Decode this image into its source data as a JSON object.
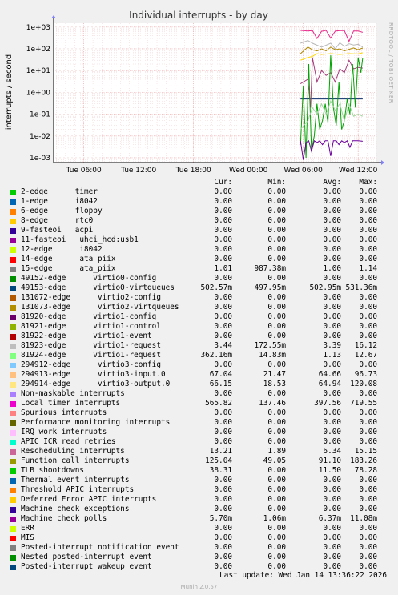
{
  "chart_data": {
    "type": "line",
    "title": "Individual interrupts - by day",
    "ylabel": "interrupts / second",
    "yscale": "log",
    "ylim": [
      0.0006,
      1500
    ],
    "y_ticks": [
      "1e+03",
      "1e+02",
      "1e+01",
      "1e+00",
      "1e-01",
      "1e-02",
      "1e-03"
    ],
    "x_ticks": [
      "Tue 06:00",
      "Tue 12:00",
      "Tue 18:00",
      "Wed 00:00",
      "Wed 06:00",
      "Wed 12:00"
    ],
    "x_range_hours": [
      -33.3,
      2.0
    ],
    "grid": true,
    "watermark": "RRDTOOL / TOBI OETIKER",
    "series": [
      {
        "name": "Local timer interrupts",
        "color": "#e7298a",
        "points": [
          [
            -6.3,
            700
          ],
          [
            -5.5,
            660
          ],
          [
            -5.0,
            690
          ],
          [
            -4.5,
            300
          ],
          [
            -4.0,
            640
          ],
          [
            -3.5,
            700
          ],
          [
            -3.0,
            310
          ],
          [
            -2.5,
            650
          ],
          [
            -2.0,
            680
          ],
          [
            -1.5,
            680
          ],
          [
            -1.0,
            220
          ],
          [
            -0.5,
            660
          ],
          [
            0,
            660
          ],
          [
            0.5,
            570
          ]
        ]
      },
      {
        "name": "virtio1-request",
        "color": "#b7b7b7",
        "points": [
          [
            -6.3,
            180
          ],
          [
            -5.5,
            240
          ],
          [
            -5.0,
            180
          ],
          [
            -4.0,
            120
          ],
          [
            -3.0,
            180
          ],
          [
            -2.5,
            100
          ],
          [
            -2.0,
            190
          ],
          [
            -1.5,
            130
          ],
          [
            -1.0,
            170
          ],
          [
            -0.5,
            150
          ],
          [
            0,
            160
          ],
          [
            0.5,
            120
          ]
        ]
      },
      {
        "name": "Function call interrupts",
        "color": "#af8800",
        "points": [
          [
            -6.3,
            60
          ],
          [
            -5.5,
            120
          ],
          [
            -5.0,
            90
          ],
          [
            -4.5,
            80
          ],
          [
            -4.0,
            100
          ],
          [
            -3.5,
            80
          ],
          [
            -3.0,
            120
          ],
          [
            -2.5,
            90
          ],
          [
            -2.0,
            100
          ],
          [
            -1.5,
            80
          ],
          [
            -1.0,
            95
          ],
          [
            -0.5,
            110
          ],
          [
            0,
            90
          ],
          [
            0.5,
            110
          ]
        ]
      },
      {
        "name": "virtio3-output.0",
        "color": "#ffd700",
        "points": [
          [
            -6.3,
            30
          ],
          [
            -5.5,
            40
          ],
          [
            -5.0,
            45
          ],
          [
            -4.5,
            60
          ],
          [
            -4.0,
            55
          ],
          [
            -3.0,
            60
          ],
          [
            -2.0,
            55
          ],
          [
            -1.0,
            60
          ],
          [
            0,
            58
          ],
          [
            0.5,
            66
          ]
        ]
      },
      {
        "name": "virtio0-virtqueues",
        "color": "#0a2c6a",
        "points": [
          [
            -6.3,
            0.5
          ],
          [
            -5.0,
            0.5
          ],
          [
            -4.0,
            0.5
          ],
          [
            -3.0,
            0.5
          ],
          [
            -2.0,
            0.5
          ],
          [
            -1.0,
            0.5
          ],
          [
            0,
            0.5
          ],
          [
            0.5,
            0.5
          ]
        ]
      },
      {
        "name": "Rescheduling interrupts",
        "color": "#a43e7d",
        "points": [
          [
            -6.3,
            2.5
          ],
          [
            -5.5,
            4
          ],
          [
            -5.2,
            0.2
          ],
          [
            -5.0,
            40
          ],
          [
            -4.5,
            3
          ],
          [
            -4.0,
            10
          ],
          [
            -3.5,
            6
          ],
          [
            -3.0,
            8
          ],
          [
            -2.5,
            3
          ],
          [
            -2.0,
            12
          ],
          [
            -1.5,
            8
          ],
          [
            -1.0,
            30
          ],
          [
            -0.5,
            12
          ],
          [
            0,
            14
          ],
          [
            0.5,
            13
          ]
        ]
      },
      {
        "name": "TLB shootdowns",
        "color": "#00a400",
        "points": [
          [
            -6.3,
            0.004
          ],
          [
            -6.0,
            2
          ],
          [
            -5.7,
            0.001
          ],
          [
            -5.4,
            20
          ],
          [
            -5.1,
            0.002
          ],
          [
            -4.8,
            0.01
          ],
          [
            -4.5,
            0.3
          ],
          [
            -4.2,
            0.02
          ],
          [
            -3.9,
            0.05
          ],
          [
            -3.6,
            0.3
          ],
          [
            -3.3,
            0.04
          ],
          [
            -3.0,
            50
          ],
          [
            -2.7,
            0.2
          ],
          [
            -2.4,
            0.03
          ],
          [
            -2.1,
            3
          ],
          [
            -1.8,
            0.02
          ],
          [
            -1.5,
            0.05
          ],
          [
            -1.2,
            0.5
          ],
          [
            -0.9,
            0.1
          ],
          [
            -0.6,
            20
          ],
          [
            -0.3,
            0.2
          ],
          [
            0,
            40
          ],
          [
            0.3,
            8
          ],
          [
            0.5,
            38
          ]
        ]
      },
      {
        "name": "virtio1-request (avg)",
        "color": "#9fd79f",
        "points": [
          [
            -6.3,
            0.02
          ],
          [
            -5.5,
            0.05
          ],
          [
            -5.0,
            0.2
          ],
          [
            -4.5,
            0.1
          ],
          [
            -4.0,
            0.3
          ],
          [
            -3.5,
            0.1
          ],
          [
            -3.0,
            0.4
          ],
          [
            -2.5,
            0.15
          ],
          [
            -2.0,
            0.3
          ],
          [
            -1.5,
            0.05
          ],
          [
            -1.0,
            0.3
          ],
          [
            -0.5,
            0.08
          ],
          [
            0,
            0.1
          ],
          [
            0.5,
            0.08
          ]
        ]
      },
      {
        "name": "Machine check polls",
        "color": "#6b009b",
        "points": [
          [
            -6.3,
            0.006
          ],
          [
            -6.0,
            0.0008
          ],
          [
            -5.7,
            0.005
          ],
          [
            -5.4,
            0.006
          ],
          [
            -5.1,
            0.002
          ],
          [
            -4.8,
            0.006
          ],
          [
            -4.5,
            0.005
          ],
          [
            -4.2,
            0.006
          ],
          [
            -3.9,
            0.004
          ],
          [
            -3.6,
            0.006
          ],
          [
            -3.3,
            0.006
          ],
          [
            -3.0,
            0.0012
          ],
          [
            -2.7,
            0.006
          ],
          [
            -2.4,
            0.006
          ],
          [
            -2.1,
            0.004
          ],
          [
            -1.8,
            0.006
          ],
          [
            -1.5,
            0.005
          ],
          [
            -1.2,
            0.006
          ],
          [
            -0.9,
            0.003
          ],
          [
            -0.6,
            0.006
          ],
          [
            -0.3,
            0.006
          ],
          [
            0,
            0.006
          ],
          [
            0.5,
            0.0057
          ]
        ]
      }
    ]
  },
  "legend": {
    "headers": {
      "cur": "Cur:",
      "min": "Min:",
      "avg": "Avg:",
      "max": "Max:"
    },
    "rows": [
      {
        "label": "2-edge      timer",
        "color": "#00cc00",
        "cur": "0.00",
        "min": "0.00",
        "avg": "0.00",
        "max": "0.00"
      },
      {
        "label": "1-edge      i8042",
        "color": "#0066b3",
        "cur": "0.00",
        "min": "0.00",
        "avg": "0.00",
        "max": "0.00"
      },
      {
        "label": "6-edge      floppy",
        "color": "#ff8000",
        "cur": "0.00",
        "min": "0.00",
        "avg": "0.00",
        "max": "0.00"
      },
      {
        "label": "8-edge      rtc0",
        "color": "#ffcc00",
        "cur": "0.00",
        "min": "0.00",
        "avg": "0.00",
        "max": "0.00"
      },
      {
        "label": "9-fasteoi   acpi",
        "color": "#330099",
        "cur": "0.00",
        "min": "0.00",
        "avg": "0.00",
        "max": "0.00"
      },
      {
        "label": "11-fasteoi   uhci_hcd:usb1",
        "color": "#990099",
        "cur": "0.00",
        "min": "0.00",
        "avg": "0.00",
        "max": "0.00"
      },
      {
        "label": "12-edge      i8042",
        "color": "#ccff00",
        "cur": "0.00",
        "min": "0.00",
        "avg": "0.00",
        "max": "0.00"
      },
      {
        "label": "14-edge      ata_piix",
        "color": "#ff0000",
        "cur": "0.00",
        "min": "0.00",
        "avg": "0.00",
        "max": "0.00"
      },
      {
        "label": "15-edge      ata_piix",
        "color": "#808080",
        "cur": "1.01",
        "min": "987.38m",
        "avg": "1.00",
        "max": "1.14"
      },
      {
        "label": "49152-edge      virtio0-config",
        "color": "#008f00",
        "cur": "0.00",
        "min": "0.00",
        "avg": "0.00",
        "max": "0.00"
      },
      {
        "label": "49153-edge      virtio0-virtqueues",
        "color": "#00487d",
        "cur": "502.57m",
        "min": "497.95m",
        "avg": "502.95m",
        "max": "531.36m"
      },
      {
        "label": "131072-edge      virtio2-config",
        "color": "#b35a00",
        "cur": "0.00",
        "min": "0.00",
        "avg": "0.00",
        "max": "0.00"
      },
      {
        "label": "131073-edge      virtio2-virtqueues",
        "color": "#b38f00",
        "cur": "0.00",
        "min": "0.00",
        "avg": "0.00",
        "max": "0.00"
      },
      {
        "label": "81920-edge      virtio1-config",
        "color": "#6b006b",
        "cur": "0.00",
        "min": "0.00",
        "avg": "0.00",
        "max": "0.00"
      },
      {
        "label": "81921-edge      virtio1-control",
        "color": "#8fb300",
        "cur": "0.00",
        "min": "0.00",
        "avg": "0.00",
        "max": "0.00"
      },
      {
        "label": "81922-edge      virtio1-event",
        "color": "#b30000",
        "cur": "0.00",
        "min": "0.00",
        "avg": "0.00",
        "max": "0.00"
      },
      {
        "label": "81923-edge      virtio1-request",
        "color": "#bebebe",
        "cur": "3.44",
        "min": "172.55m",
        "avg": "3.39",
        "max": "16.12"
      },
      {
        "label": "81924-edge      virtio1-request",
        "color": "#80ff80",
        "cur": "362.16m",
        "min": "14.83m",
        "avg": "1.13",
        "max": "12.67"
      },
      {
        "label": "294912-edge      virtio3-config",
        "color": "#80c9ff",
        "cur": "0.00",
        "min": "0.00",
        "avg": "0.00",
        "max": "0.00"
      },
      {
        "label": "294913-edge      virtio3-input.0",
        "color": "#ffc080",
        "cur": "67.04",
        "min": "21.47",
        "avg": "64.66",
        "max": "96.73"
      },
      {
        "label": "294914-edge      virtio3-output.0",
        "color": "#ffe680",
        "cur": "66.15",
        "min": "18.53",
        "avg": "64.94",
        "max": "120.08"
      },
      {
        "label": "Non-maskable interrupts",
        "color": "#aa80ff",
        "cur": "0.00",
        "min": "0.00",
        "avg": "0.00",
        "max": "0.00"
      },
      {
        "label": "Local timer interrupts",
        "color": "#ee00cc",
        "cur": "565.82",
        "min": "137.46",
        "avg": "397.56",
        "max": "719.55"
      },
      {
        "label": "Spurious interrupts",
        "color": "#ff8080",
        "cur": "0.00",
        "min": "0.00",
        "avg": "0.00",
        "max": "0.00"
      },
      {
        "label": "Performance monitoring interrupts",
        "color": "#666600",
        "cur": "0.00",
        "min": "0.00",
        "avg": "0.00",
        "max": "0.00"
      },
      {
        "label": "IRQ work interrupts",
        "color": "#ffbfff",
        "cur": "0.00",
        "min": "0.00",
        "avg": "0.00",
        "max": "0.00"
      },
      {
        "label": "APIC ICR read retries",
        "color": "#00ffcc",
        "cur": "0.00",
        "min": "0.00",
        "avg": "0.00",
        "max": "0.00"
      },
      {
        "label": "Rescheduling interrupts",
        "color": "#cc6699",
        "cur": "13.21",
        "min": "1.89",
        "avg": "6.34",
        "max": "15.15"
      },
      {
        "label": "Function call interrupts",
        "color": "#999900",
        "cur": "125.04",
        "min": "49.05",
        "avg": "91.10",
        "max": "183.26"
      },
      {
        "label": "TLB shootdowns",
        "color": "#00cc00",
        "cur": "38.31",
        "min": "0.00",
        "avg": "11.50",
        "max": "78.28"
      },
      {
        "label": "Thermal event interrupts",
        "color": "#0066b3",
        "cur": "0.00",
        "min": "0.00",
        "avg": "0.00",
        "max": "0.00"
      },
      {
        "label": "Threshold APIC interrupts",
        "color": "#ff8000",
        "cur": "0.00",
        "min": "0.00",
        "avg": "0.00",
        "max": "0.00"
      },
      {
        "label": "Deferred Error APIC interrupts",
        "color": "#ffcc00",
        "cur": "0.00",
        "min": "0.00",
        "avg": "0.00",
        "max": "0.00"
      },
      {
        "label": "Machine check exceptions",
        "color": "#330099",
        "cur": "0.00",
        "min": "0.00",
        "avg": "0.00",
        "max": "0.00"
      },
      {
        "label": "Machine check polls",
        "color": "#990099",
        "cur": "5.70m",
        "min": "1.06m",
        "avg": "6.37m",
        "max": "11.08m"
      },
      {
        "label": "ERR",
        "color": "#ccff00",
        "cur": "0.00",
        "min": "0.00",
        "avg": "0.00",
        "max": "0.00"
      },
      {
        "label": "MIS",
        "color": "#ff0000",
        "cur": "0.00",
        "min": "0.00",
        "avg": "0.00",
        "max": "0.00"
      },
      {
        "label": "Posted-interrupt notification event",
        "color": "#808080",
        "cur": "0.00",
        "min": "0.00",
        "avg": "0.00",
        "max": "0.00"
      },
      {
        "label": "Nested posted-interrupt event",
        "color": "#008f00",
        "cur": "0.00",
        "min": "0.00",
        "avg": "0.00",
        "max": "0.00"
      },
      {
        "label": "Posted-interrupt wakeup event",
        "color": "#00487d",
        "cur": "0.00",
        "min": "0.00",
        "avg": "0.00",
        "max": "0.00"
      }
    ]
  },
  "last_update": "Last update: Wed Jan 14 13:36:22 2026",
  "footer": "Munin 2.0.57"
}
